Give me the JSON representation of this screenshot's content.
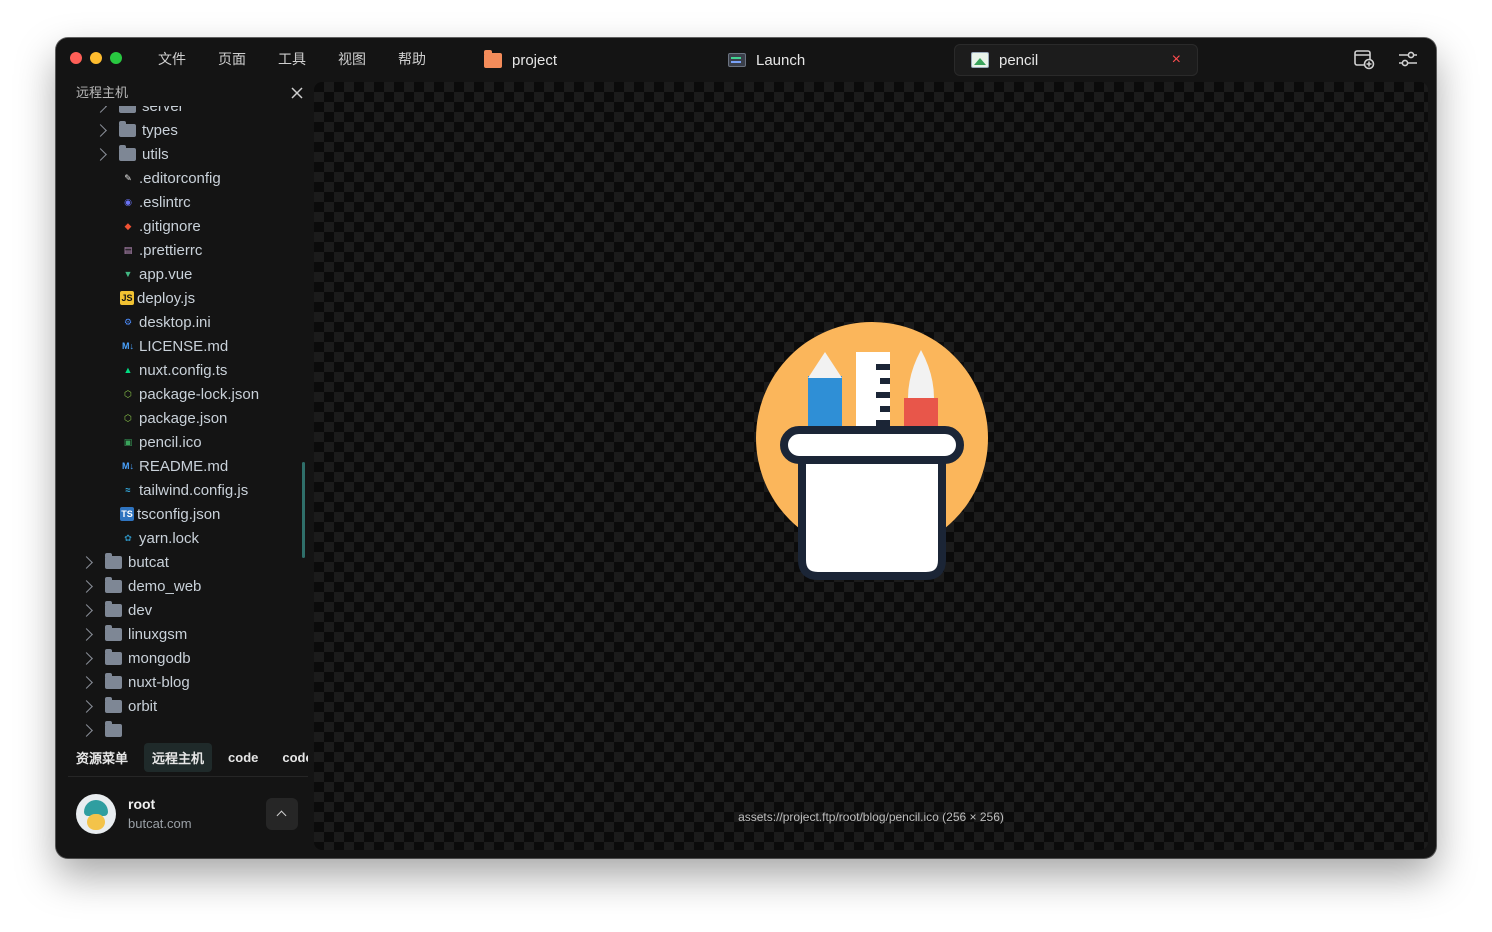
{
  "menu": [
    "文件",
    "页面",
    "工具",
    "视图",
    "帮助"
  ],
  "tabs": {
    "project": "project",
    "launch": "Launch",
    "pencil": "pencil",
    "close_symbol": "×"
  },
  "sidebar": {
    "title": "远程主机",
    "tree": [
      {
        "label": "server",
        "kind": "folder",
        "level": 1
      },
      {
        "label": "types",
        "kind": "folder",
        "level": 1
      },
      {
        "label": "utils",
        "kind": "folder",
        "level": 1
      },
      {
        "label": ".editorconfig",
        "kind": "editorconfig",
        "level": 2
      },
      {
        "label": ".eslintrc",
        "kind": "eslint",
        "level": 2
      },
      {
        "label": ".gitignore",
        "kind": "git",
        "level": 2
      },
      {
        "label": ".prettierrc",
        "kind": "prettier",
        "level": 2
      },
      {
        "label": "app.vue",
        "kind": "vue",
        "level": 2
      },
      {
        "label": "deploy.js",
        "kind": "js",
        "level": 2
      },
      {
        "label": "desktop.ini",
        "kind": "gear",
        "level": 2
      },
      {
        "label": "LICENSE.md",
        "kind": "markdown",
        "level": 2
      },
      {
        "label": "nuxt.config.ts",
        "kind": "nuxt",
        "level": 2
      },
      {
        "label": "package-lock.json",
        "kind": "node",
        "level": 2
      },
      {
        "label": "package.json",
        "kind": "node",
        "level": 2
      },
      {
        "label": "pencil.ico",
        "kind": "image",
        "level": 2
      },
      {
        "label": "README.md",
        "kind": "markdown",
        "level": 2
      },
      {
        "label": "tailwind.config.js",
        "kind": "tailwind",
        "level": 2
      },
      {
        "label": "tsconfig.json",
        "kind": "ts",
        "level": 2
      },
      {
        "label": "yarn.lock",
        "kind": "yarn",
        "level": 2
      },
      {
        "label": "butcat",
        "kind": "folder",
        "level": 0
      },
      {
        "label": "demo_web",
        "kind": "folder",
        "level": 0
      },
      {
        "label": "dev",
        "kind": "folder",
        "level": 0
      },
      {
        "label": "linuxgsm",
        "kind": "folder",
        "level": 0
      },
      {
        "label": "mongodb",
        "kind": "folder",
        "level": 0
      },
      {
        "label": "nuxt-blog",
        "kind": "folder",
        "level": 0
      },
      {
        "label": "orbit",
        "kind": "folder",
        "level": 0
      },
      {
        "label": "",
        "kind": "folder",
        "level": 0
      }
    ],
    "bottom_tabs": [
      "资源菜单",
      "远程主机",
      "code",
      "code"
    ],
    "active_bottom_tab": 1
  },
  "user": {
    "name": "root",
    "host": "butcat.com"
  },
  "viewer": {
    "caption": "assets://project.ftp/root/blog/pencil.ico (256 × 256)"
  },
  "colors": {
    "window_bg": "#141414",
    "close_red": "#ff4d4f",
    "icon_circle": "#fbb65b",
    "icon_dark": "#1b2536",
    "pencil_blue": "#2f8fd6",
    "brush_red": "#e8564a"
  }
}
